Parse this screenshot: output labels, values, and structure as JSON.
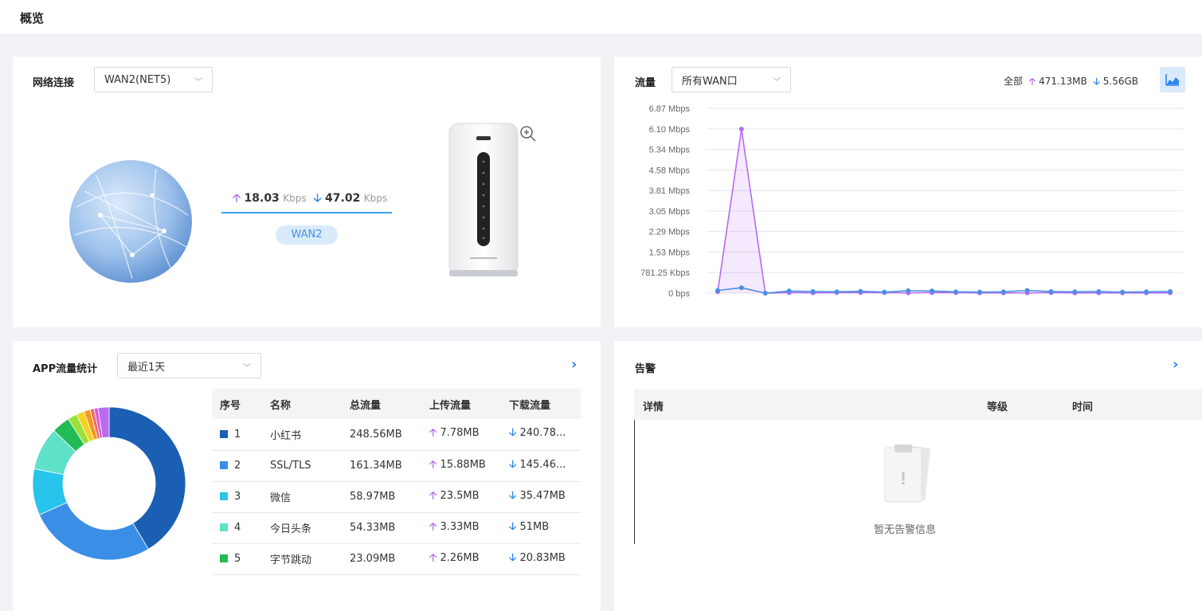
{
  "page": {
    "title": "概览"
  },
  "network": {
    "title": "网络连接",
    "select_value": "WAN2(NET5)",
    "up_value": "18.03",
    "up_unit": "Kbps",
    "down_value": "47.02",
    "down_unit": "Kbps",
    "link_label": "WAN2"
  },
  "traffic": {
    "title": "流量",
    "select_value": "所有WAN口",
    "summary_label": "全部",
    "up_total": "471.13MB",
    "down_total": "5.56GB"
  },
  "chart_data": {
    "type": "area",
    "title": "",
    "xlabel": "",
    "ylabel": "",
    "y_ticks": [
      "0 bps",
      "781.25 Kbps",
      "1.53 Mbps",
      "2.29 Mbps",
      "3.05 Mbps",
      "3.81 Mbps",
      "4.58 Mbps",
      "5.34 Mbps",
      "6.10 Mbps",
      "6.87 Mbps"
    ],
    "ylim": [
      0,
      6.87
    ],
    "y_unit": "Mbps",
    "grid": true,
    "series": [
      {
        "color": "#b66bf2",
        "values": [
          0.05,
          6.1,
          0.0,
          0.02,
          0.01,
          0.02,
          0.02,
          0.02,
          0.01,
          0.02,
          0.02,
          0.01,
          0.01,
          0.01,
          0.02,
          0.01,
          0.01,
          0.01,
          0.01,
          0.01
        ]
      },
      {
        "color": "#4a90e2",
        "values": [
          0.1,
          0.2,
          0.0,
          0.08,
          0.06,
          0.05,
          0.07,
          0.04,
          0.09,
          0.08,
          0.05,
          0.04,
          0.05,
          0.1,
          0.06,
          0.05,
          0.06,
          0.04,
          0.05,
          0.06
        ]
      }
    ]
  },
  "apps": {
    "title": "APP流量统计",
    "select_value": "最近1天",
    "columns": [
      "序号",
      "名称",
      "总流量",
      "上传流量",
      "下载流量"
    ],
    "rows": [
      {
        "idx": "1",
        "color": "#1a5fb4",
        "name": "小红书",
        "total": "248.56MB",
        "up": "7.78MB",
        "down": "240.78..."
      },
      {
        "idx": "2",
        "color": "#3a8ee6",
        "name": "SSL/TLS",
        "total": "161.34MB",
        "up": "15.88MB",
        "down": "145.46..."
      },
      {
        "idx": "3",
        "color": "#28c4ec",
        "name": "微信",
        "total": "58.97MB",
        "up": "23.5MB",
        "down": "35.47MB"
      },
      {
        "idx": "4",
        "color": "#5fe0c8",
        "name": "今日头条",
        "total": "54.33MB",
        "up": "3.33MB",
        "down": "51MB"
      },
      {
        "idx": "5",
        "color": "#22bb55",
        "name": "字节跳动",
        "total": "23.09MB",
        "up": "2.26MB",
        "down": "20.83MB"
      }
    ],
    "donut": [
      {
        "color": "#1a5fb4",
        "value": 248.56
      },
      {
        "color": "#3a8ee6",
        "value": 161.34
      },
      {
        "color": "#28c4ec",
        "value": 58.97
      },
      {
        "color": "#5fe0c8",
        "value": 54.33
      },
      {
        "color": "#22bb55",
        "value": 23.09
      },
      {
        "color": "#9be03a",
        "value": 12
      },
      {
        "color": "#f5d020",
        "value": 10
      },
      {
        "color": "#f59a23",
        "value": 8
      },
      {
        "color": "#f06a6a",
        "value": 5
      },
      {
        "color": "#e05acb",
        "value": 5
      },
      {
        "color": "#b86bf0",
        "value": 14
      }
    ]
  },
  "alarm": {
    "title": "告警",
    "columns": [
      "详情",
      "等级",
      "时间"
    ],
    "empty_text": "暂无告警信息"
  }
}
